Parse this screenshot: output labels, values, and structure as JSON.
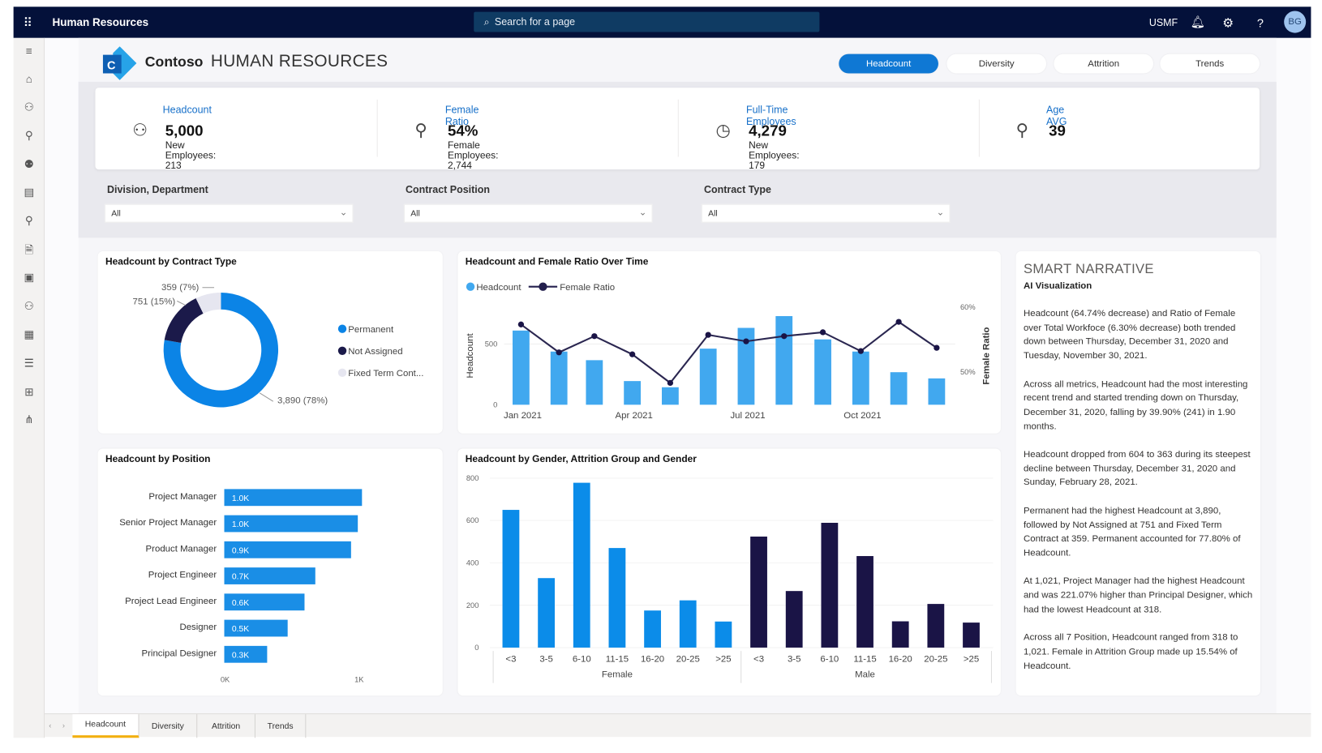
{
  "topbar": {
    "app_title": "Human Resources",
    "search_placeholder": "Search for a page",
    "company": "USMF",
    "avatar_initials": "BG"
  },
  "header": {
    "brand": "Contoso",
    "title": "HUMAN RESOURCES",
    "tabs": [
      {
        "label": "Headcount",
        "active": true
      },
      {
        "label": "Diversity"
      },
      {
        "label": "Attrition"
      },
      {
        "label": "Trends"
      }
    ]
  },
  "kpis": [
    {
      "title": "Headcount",
      "value": "5,000",
      "sub": "New Employees: 213",
      "icon": "people-icon"
    },
    {
      "title": "Female Ratio",
      "value": "54%",
      "sub": "Female Employees: 2,744",
      "icon": "female-icon"
    },
    {
      "title": "Full-Time Employees",
      "value": "4,279",
      "sub": "New Employees: 179",
      "icon": "clock-icon"
    },
    {
      "title": "Age AVG",
      "value": "39",
      "sub": "",
      "icon": "person-chart-icon"
    }
  ],
  "filters": [
    {
      "label": "Division, Department",
      "value": "All"
    },
    {
      "label": "Contract Position",
      "value": "All"
    },
    {
      "label": "Contract Type",
      "value": "All"
    }
  ],
  "colors": {
    "accent": "#0f78d4",
    "topbar": "#04113a",
    "kpi_title": "#1770c9",
    "light_bar": "#41a8ef",
    "female": "#0b8ce9",
    "male": "#1a1446",
    "permanent": "#0b84e6",
    "not_assigned": "#1b1a4a",
    "fixed": "#e6e6f0"
  },
  "narrative": {
    "title": "SMART NARRATIVE",
    "subtitle": "AI Visualization",
    "paragraphs": [
      "Headcount (64.74% decrease) and Ratio of Female over Total Workfoce (6.30% decrease) both trended down between Thursday, December 31, 2020 and Tuesday, November 30, 2021.",
      "Across all metrics, Headcount had the most interesting recent trend and started trending down on Thursday, December 31, 2020, falling by 39.90% (241) in 1.90 months.",
      "Headcount dropped from 604 to 363 during its steepest decline between Thursday, December 31, 2020 and Sunday, February 28, 2021.",
      "Permanent had the highest Headcount at 3,890, followed by Not Assigned at 751 and Fixed Term Contract at 359. Permanent accounted for 77.80% of Headcount.",
      "At 1,021, Project Manager had the highest Headcount and was 221.07% higher than Principal Designer, which had the lowest Headcount at 318.",
      "Across all 7 Position, Headcount ranged from 318 to 1,021.  Female in Attrition Group  made up 15.54% of Headcount."
    ]
  },
  "bottom_tabs": [
    {
      "label": "Headcount",
      "active": true
    },
    {
      "label": "Diversity"
    },
    {
      "label": "Attrition"
    },
    {
      "label": "Trends"
    }
  ],
  "chart_data": [
    {
      "type": "pie",
      "title": "Headcount by Contract Type",
      "categories": [
        "Permanent",
        "Not Assigned",
        "Fixed Term Cont..."
      ],
      "values": [
        3890,
        751,
        359
      ],
      "data_labels": [
        "3,890 (78%)",
        "751 (15%)",
        "359 (7%)"
      ],
      "legend": "right"
    },
    {
      "type": "bar+line",
      "title": "Headcount and Female Ratio Over Time",
      "x": [
        "2021-01",
        "2021-02",
        "2021-03",
        "2021-04",
        "2021-05",
        "2021-06",
        "2021-07",
        "2021-08",
        "2021-09",
        "2021-10",
        "2021-11",
        "2021-12"
      ],
      "x_tick_labels": [
        "Jan 2021",
        "Apr 2021",
        "Jul 2021",
        "Oct 2021"
      ],
      "series": [
        {
          "name": "Headcount",
          "type": "bar",
          "axis": "left",
          "values": [
            611,
            438,
            367,
            195,
            144,
            462,
            633,
            730,
            538,
            438,
            268,
            217
          ]
        },
        {
          "name": "Female Ratio",
          "type": "line",
          "axis": "right",
          "values": [
            57.3,
            53.0,
            55.5,
            52.7,
            48.3,
            55.7,
            54.7,
            55.5,
            56.1,
            53.2,
            57.7,
            53.7
          ]
        }
      ],
      "ylabel": "Headcount",
      "y2label": "Female Ratio",
      "y_ticks": [
        "0",
        "500"
      ],
      "y2_ticks": [
        "50%",
        "60%"
      ],
      "legend": "top-left"
    },
    {
      "type": "bar",
      "orientation": "horizontal",
      "title": "Headcount by Position",
      "categories": [
        "Project Manager",
        "Senior Project Manager",
        "Product Manager",
        "Project Engineer",
        "Project Lead Engineer",
        "Designer",
        "Principal Designer"
      ],
      "values": [
        1021,
        990,
        940,
        675,
        595,
        470,
        318
      ],
      "data_labels": [
        "1.0K",
        "1.0K",
        "0.9K",
        "0.7K",
        "0.6K",
        "0.5K",
        "0.3K"
      ],
      "x_ticks": [
        "0K",
        "1K"
      ],
      "xlim": [
        0,
        1000
      ]
    },
    {
      "type": "bar",
      "title": "Headcount by Gender, Attrition Group and Gender",
      "groups": [
        "Female",
        "Male"
      ],
      "categories": [
        "<3",
        "3-5",
        "6-10",
        "11-15",
        "16-20",
        "20-25",
        ">25"
      ],
      "series": [
        {
          "group": "Female",
          "values": [
            650,
            328,
            778,
            470,
            175,
            223,
            123
          ]
        },
        {
          "group": "Male",
          "values": [
            524,
            267,
            589,
            432,
            124,
            206,
            118
          ]
        }
      ],
      "y_ticks": [
        "0",
        "200",
        "400",
        "600",
        "800"
      ],
      "ylim": [
        0,
        800
      ]
    }
  ]
}
